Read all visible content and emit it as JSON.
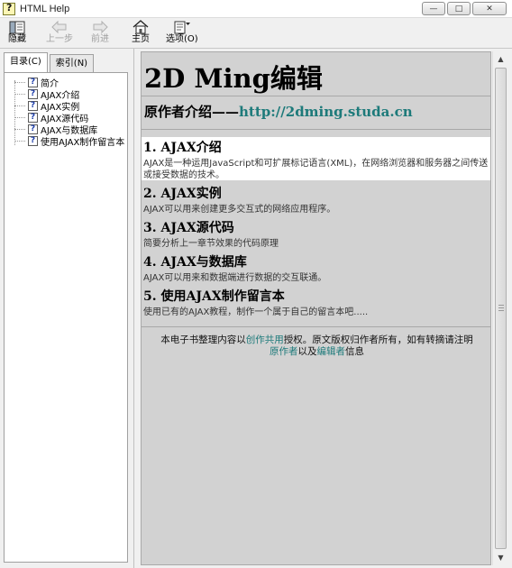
{
  "window": {
    "title": "HTML Help",
    "minimize": "—",
    "restore": "□",
    "close": "✕"
  },
  "toolbar": {
    "hide": "隐藏",
    "back": "上一步",
    "forward": "前进",
    "home": "主页",
    "options": "选项(O)"
  },
  "nav": {
    "tabs": [
      "目录(C)",
      "索引(N)"
    ],
    "active_tab": 0,
    "items": [
      "简介",
      "AJAX介绍",
      "AJAX实例",
      "AJAX源代码",
      "AJAX与数据库",
      "使用AJAX制作留言本"
    ]
  },
  "content": {
    "title": "2D Ming编辑",
    "author_label": "原作者介绍",
    "author_sep": "——",
    "author_link": "http://2dming.studa.cn",
    "sections": [
      {
        "heading": "1. AJAX介绍",
        "desc": "AJAX是一种运用JavaScript和可扩展标记语言(XML)，在网络浏览器和服务器之间传送或接受数据的技术。"
      },
      {
        "heading": "2. AJAX实例",
        "desc": "AJAX可以用来创建更多交互式的网络应用程序。"
      },
      {
        "heading": "3. AJAX源代码",
        "desc": "简要分析上一章节效果的代码原理"
      },
      {
        "heading": "4. AJAX与数据库",
        "desc": "AJAX可以用来和数据端进行数据的交互联通。"
      },
      {
        "heading": "5. 使用AJAX制作留言本",
        "desc": "使用已有的AJAX教程，制作一个属于自己的留言本吧....."
      }
    ],
    "footer": {
      "part1": "本电子书整理内容以",
      "link1": "创作共用",
      "part2": "授权。原文版权归作者所有，如有转摘请注明",
      "link2": "原作者",
      "part3": "以及",
      "link3": "编辑者",
      "part4": "信息"
    }
  },
  "colors": {
    "link": "#1d7a7a",
    "content_bg": "#d2d2d2",
    "highlight_bg": "#ffffff"
  }
}
